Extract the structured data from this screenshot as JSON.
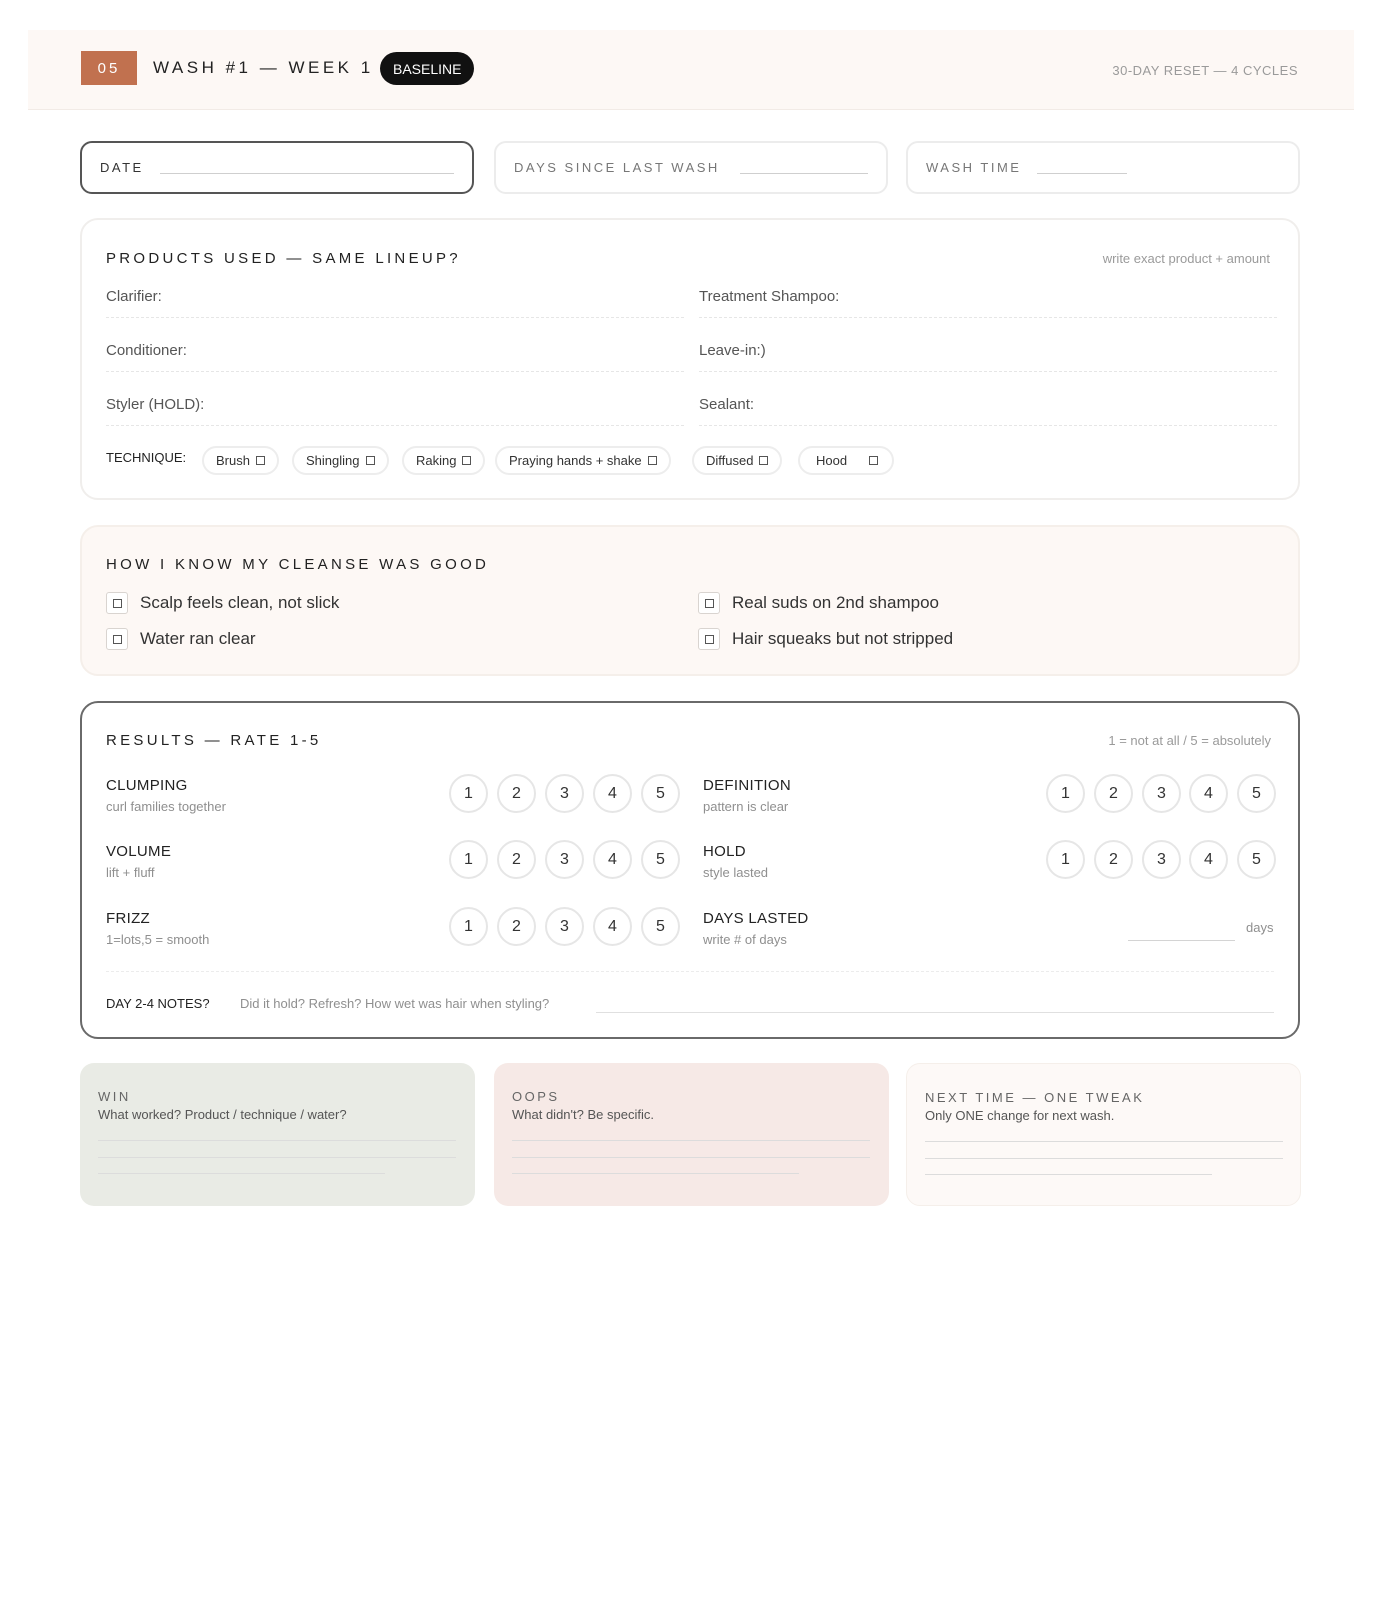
{
  "header": {
    "number": "05",
    "title": "WASH #1 — WEEK 1",
    "badge": "BASELINE",
    "right_text": "30-DAY RESET — 4 CYCLES"
  },
  "fields": {
    "date": "DATE",
    "days_since": "DAYS SINCE LAST WASH",
    "wash_time": "WASH TIME"
  },
  "products": {
    "title": "PRODUCTS USED — SAME LINEUP?",
    "note": "write exact product + amount",
    "clarifier": "Clarifier:",
    "treatment": "Treatment Shampoo:",
    "conditioner": "Conditioner:",
    "leavein": "Leave-in:)",
    "styler": "Styler (HOLD):",
    "sealant": "Sealant:",
    "technique_label": "TECHNIQUE:",
    "techniques": [
      "Brush",
      "Shingling",
      "Raking",
      "Praying hands + shake",
      "Diffused",
      "Hood"
    ]
  },
  "cleanse": {
    "title": "HOW I KNOW MY CLEANSE WAS GOOD",
    "items": [
      "Scalp feels clean, not slick",
      "Real suds on 2nd shampoo",
      "Water ran clear",
      "Hair squeaks but not stripped"
    ]
  },
  "results": {
    "title": "RESULTS — RATE 1-5",
    "note": "1 = not at all / 5 = absolutely",
    "scale": [
      "1",
      "2",
      "3",
      "4",
      "5"
    ],
    "clumping": {
      "label": "CLUMPING",
      "sub": "curl families together"
    },
    "definition": {
      "label": "DEFINITION",
      "sub": "pattern is clear"
    },
    "volume": {
      "label": "VOLUME",
      "sub": "lift + fluff"
    },
    "hold": {
      "label": "HOLD",
      "sub": "style lasted"
    },
    "frizz": {
      "label": "FRIZZ",
      "sub": "1=lots,5 = smooth"
    },
    "days_lasted": {
      "label": "DAYS LASTED",
      "sub": "write # of days",
      "unit": "days"
    },
    "notes_label": "DAY 2-4 NOTES?",
    "notes_prompt": "Did it hold? Refresh? How wet was hair when styling?"
  },
  "review": {
    "win": {
      "title": "WIN",
      "sub": "What worked? Product / technique / water?"
    },
    "oops": {
      "title": "OOPS",
      "sub": "What didn't? Be specific."
    },
    "next": {
      "title": "NEXT TIME — ONE TWEAK",
      "sub": "Only ONE change for next wash."
    }
  },
  "colors": {
    "accent": "#c1714f",
    "header_bg": "#fdf8f5",
    "win_bg": "#e9ebe5",
    "oops_bg": "#f6e9e6",
    "next_bg": "#fdf9f7"
  }
}
